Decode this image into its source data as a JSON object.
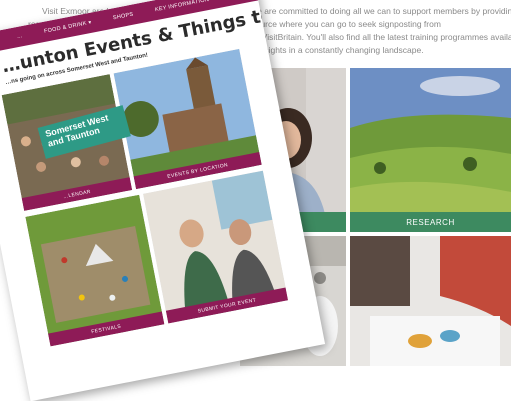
{
  "intro": {
    "line1": "Visit Exmoor are here to support our tourism business. We are committed to doing all we can to support members by providing the",
    "line2": "resources to manage… Exmoor Business Hub – a single resource where you can go to seek signposting from",
    "line3": "associations and VisitBritain. You'll also find all the latest training programmes available",
    "line4": "ing practical insights in a constantly changing landscape."
  },
  "tiles": {
    "tile_left_caption": "…NCE",
    "tile_right_caption": "RESEARCH"
  },
  "mockup": {
    "nav": [
      "…",
      "FOOD & DRINK ▾",
      "SHOPS",
      "KEY INFORMATION ▾"
    ],
    "title": "…unton Events & Things to Do",
    "subtitle": "…ns going on across Somerset West and Taunton!",
    "badge": "Somerset West and Taunton",
    "bars": {
      "calendar": "…LENDAR",
      "events_by_location": "EVENTS BY LOCATION",
      "festivals": "FESTIVALS",
      "submit_event": "SUBMIT YOUR EVENT"
    }
  },
  "colors": {
    "brand_purple": "#8e1b57",
    "green": "#3d8a60",
    "teal": "#2e9a86"
  }
}
